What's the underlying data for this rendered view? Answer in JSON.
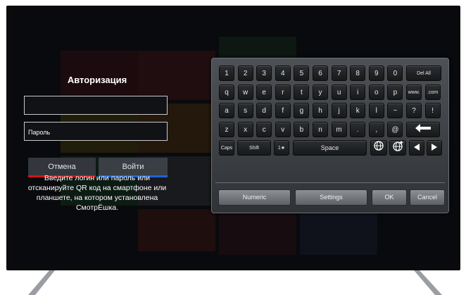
{
  "login": {
    "title": "Авторизация",
    "login_value": "",
    "password_placeholder": "Пароль",
    "cancel_label": "Отмена",
    "submit_label": "Войти",
    "hint": "Введите логин или пароль или отсканируйте QR код на смартфоне или планшете, на котором установлена СмотрЁшка."
  },
  "keyboard": {
    "rows": [
      [
        "1",
        "2",
        "3",
        "4",
        "5",
        "6",
        "7",
        "8",
        "9",
        "0",
        "Del All"
      ],
      [
        "q",
        "w",
        "e",
        "r",
        "t",
        "y",
        "u",
        "i",
        "o",
        "p",
        "www.",
        ".com"
      ],
      [
        "a",
        "s",
        "d",
        "f",
        "g",
        "h",
        "j",
        "k",
        "l",
        "~",
        "?",
        "!"
      ],
      [
        "z",
        "x",
        "c",
        "v",
        "b",
        "n",
        "m",
        ".",
        ",",
        "@"
      ]
    ],
    "row5": {
      "caps": "Caps",
      "shift": "Shift",
      "symbols": "1★",
      "space": "Space"
    },
    "bottom": {
      "numeric": "Numeric",
      "settings": "Settings",
      "ok": "OK",
      "cancel": "Cancel"
    }
  },
  "icons": {
    "backspace": "arrow-left-icon",
    "globe": "globe-icon",
    "globe_plus": "globe-plus-icon",
    "left": "triangle-left-icon",
    "right": "triangle-right-icon"
  },
  "colors": {
    "cancel_accent": "#d01616",
    "submit_accent": "#1f64d8"
  }
}
